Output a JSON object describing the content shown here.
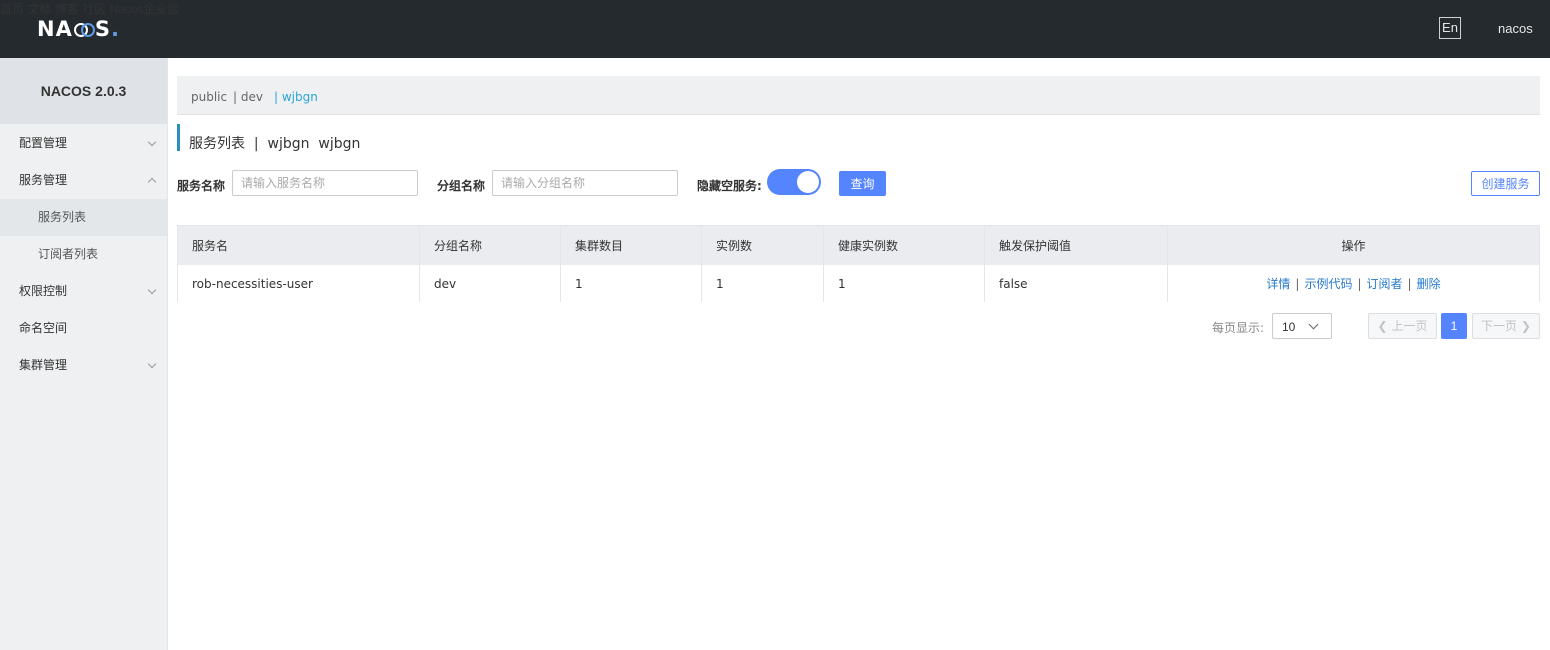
{
  "header": {
    "logo_text": "NACOS.",
    "nav": [
      "首页",
      "文档",
      "博客",
      "社区",
      "Nacos企业版"
    ],
    "lang_button": "En",
    "user": "nacos"
  },
  "sidebar": {
    "title": "NACOS 2.0.3",
    "items": [
      {
        "label": "配置管理"
      },
      {
        "label": "服务管理"
      },
      {
        "label": "服务列表"
      },
      {
        "label": "订阅者列表"
      },
      {
        "label": "权限控制"
      },
      {
        "label": "命名空间"
      },
      {
        "label": "集群管理"
      }
    ]
  },
  "namespace_bar": {
    "items": [
      "public",
      "| dev",
      "| wjbgn"
    ]
  },
  "page": {
    "title": "服务列表  |  wjbgn  wjbgn"
  },
  "filters": {
    "service_name_label": "服务名称",
    "service_name_placeholder": "请输入服务名称",
    "service_name_value": "",
    "group_name_label": "分组名称",
    "group_name_placeholder": "请输入分组名称",
    "group_name_value": "",
    "hide_empty_label": "隐藏空服务:",
    "hide_empty_on": true,
    "query_button": "查询",
    "create_button": "创建服务"
  },
  "table": {
    "columns": [
      "服务名",
      "分组名称",
      "集群数目",
      "实例数",
      "健康实例数",
      "触发保护阈值",
      "操作"
    ],
    "rows": [
      {
        "service": "rob-necessities-user",
        "group": "dev",
        "clusters": "1",
        "instances": "1",
        "healthy": "1",
        "threshold": "false",
        "actions": [
          "详情",
          "示例代码",
          "订阅者",
          "删除"
        ]
      }
    ]
  },
  "pagination": {
    "per_page_label": "每页显示:",
    "per_page_value": "10",
    "prev": "上一页",
    "current_page": "1",
    "next": "下一页"
  },
  "colors": {
    "header_bg": "#252a2f",
    "primary": "#5584ff",
    "link": "#2479cc",
    "namespace_active": "#2ba5d6"
  }
}
